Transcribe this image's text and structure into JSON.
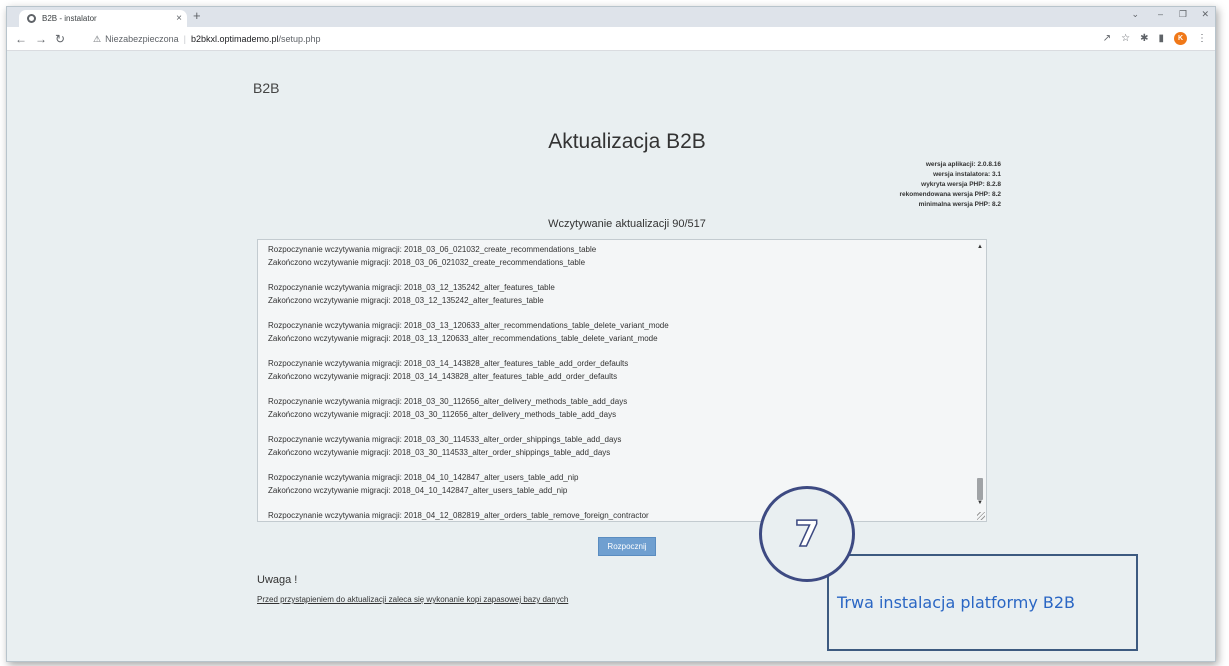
{
  "browser": {
    "tab_title": "B2B - instalator",
    "tab_close": "×",
    "new_tab": "+",
    "security_label": "Niezabezpieczona",
    "url_host": "b2bkxl.optimademo.pl",
    "url_path": "/setup.php",
    "avatar_letter": "K"
  },
  "page": {
    "brand": "B2B",
    "title": "Aktualizacja B2B",
    "versions": [
      "wersja aplikacji: 2.0.8.16",
      "wersja instalatora: 3.1",
      "wykryta wersja PHP: 8.2.8",
      "rekomendowana wersja PHP: 8.2",
      "minimalna wersja PHP: 8.2"
    ],
    "progress_title": "Wczytywanie aktualizacji 90/517",
    "log": [
      [
        "Rozpoczynanie wczytywania migracji: 2018_03_06_021032_create_recommendations_table",
        "Zakończono wczytywanie migracji: 2018_03_06_021032_create_recommendations_table"
      ],
      [
        "Rozpoczynanie wczytywania migracji: 2018_03_12_135242_alter_features_table",
        "Zakończono wczytywanie migracji: 2018_03_12_135242_alter_features_table"
      ],
      [
        "Rozpoczynanie wczytywania migracji: 2018_03_13_120633_alter_recommendations_table_delete_variant_mode",
        "Zakończono wczytywanie migracji: 2018_03_13_120633_alter_recommendations_table_delete_variant_mode"
      ],
      [
        "Rozpoczynanie wczytywania migracji: 2018_03_14_143828_alter_features_table_add_order_defaults",
        "Zakończono wczytywanie migracji: 2018_03_14_143828_alter_features_table_add_order_defaults"
      ],
      [
        "Rozpoczynanie wczytywania migracji: 2018_03_30_112656_alter_delivery_methods_table_add_days",
        "Zakończono wczytywanie migracji: 2018_03_30_112656_alter_delivery_methods_table_add_days"
      ],
      [
        "Rozpoczynanie wczytywania migracji: 2018_03_30_114533_alter_order_shippings_table_add_days",
        "Zakończono wczytywanie migracji: 2018_03_30_114533_alter_order_shippings_table_add_days"
      ],
      [
        "Rozpoczynanie wczytywania migracji: 2018_04_10_142847_alter_users_table_add_nip",
        "Zakończono wczytywanie migracji: 2018_04_10_142847_alter_users_table_add_nip"
      ],
      [
        "Rozpoczynanie wczytywania migracji: 2018_04_12_082819_alter_orders_table_remove_foreign_contractor",
        ""
      ]
    ],
    "start_button": "Rozpocznij",
    "warning_title": "Uwaga !",
    "warning_text": "Przed przystąpieniem do aktualizacji zaleca się wykonanie kopi zapasowej bazy danych"
  },
  "annotation": {
    "step_number": "7",
    "callout_text": "Trwa instalacja platformy B2B"
  }
}
